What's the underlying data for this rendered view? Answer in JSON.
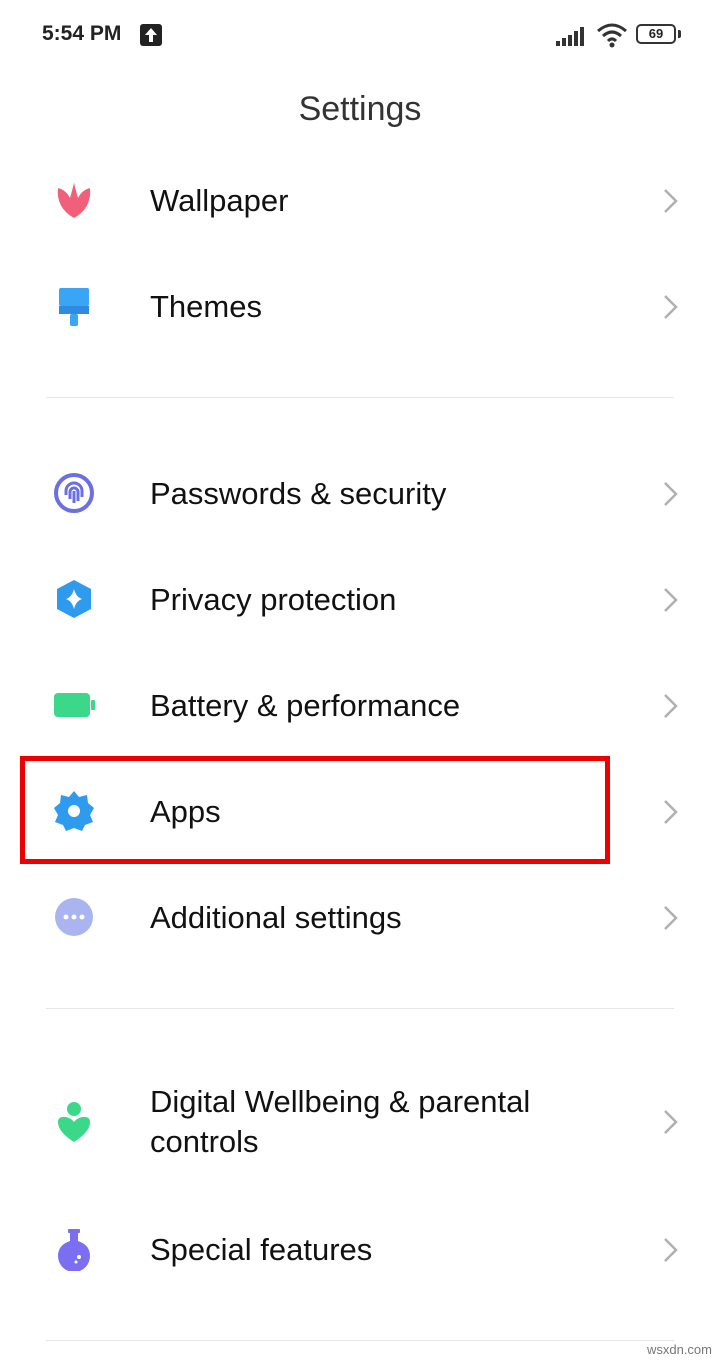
{
  "status_bar": {
    "time": "5:54 PM",
    "battery_level": "69"
  },
  "title": "Settings",
  "settings_items": [
    {
      "label": "Wallpaper",
      "icon": "wallpaper-icon",
      "color": "#F0607A"
    },
    {
      "label": "Themes",
      "icon": "themes-icon",
      "color": "#3AA4F5"
    },
    {
      "label": "Passwords & security",
      "icon": "fingerprint-icon",
      "color": "#6C6FE0"
    },
    {
      "label": "Privacy protection",
      "icon": "privacy-icon",
      "color": "#2E9BEF"
    },
    {
      "label": "Battery & performance",
      "icon": "battery-icon",
      "color": "#3CD88A"
    },
    {
      "label": "Apps",
      "icon": "gear-icon",
      "color": "#2E9BEF"
    },
    {
      "label": "Additional settings",
      "icon": "more-icon",
      "color": "#A9B4F0"
    },
    {
      "label": "Digital Wellbeing & parental controls",
      "label_line1": "Digital Wellbeing & parental",
      "label_line2": "controls",
      "icon": "wellbeing-icon",
      "color": "#3CD88A"
    },
    {
      "label": "Special features",
      "icon": "special-features-icon",
      "color": "#7C6EF0"
    }
  ],
  "highlight": {
    "target": "Apps",
    "color": "#EE0000"
  },
  "watermark": "wsxdn.com"
}
